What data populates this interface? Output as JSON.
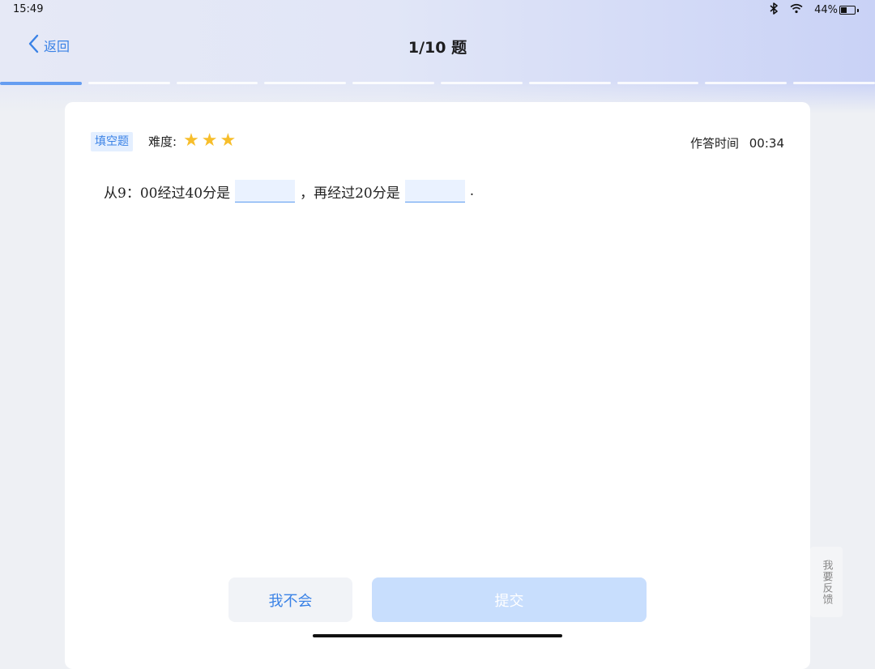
{
  "status_bar": {
    "time": "15:49",
    "battery": "44%",
    "battery_level": 0.44,
    "icons": [
      "bluetooth-icon",
      "wifi-icon",
      "battery-icon"
    ]
  },
  "nav": {
    "back_label": "返回",
    "title": "1/10 题"
  },
  "progress": {
    "current": 1,
    "total": 10
  },
  "question": {
    "type_label": "填空题",
    "difficulty_label": "难度:",
    "difficulty_stars": 3,
    "timer_label": "作答时间",
    "timer_value": "00:34",
    "segments": {
      "part1": "从9：00经过40分是",
      "part2": "，再经过20分是",
      "part3": "."
    },
    "blanks": [
      {
        "value": ""
      },
      {
        "value": ""
      }
    ]
  },
  "actions": {
    "dont_know_label": "我不会",
    "submit_label": "提交"
  },
  "feedback": {
    "label": "我要反馈"
  },
  "colors": {
    "accent": "#3a82e6",
    "star": "#f7be2b",
    "submit_disabled": "#c8defd",
    "blank_bg": "#eaf2ff"
  }
}
